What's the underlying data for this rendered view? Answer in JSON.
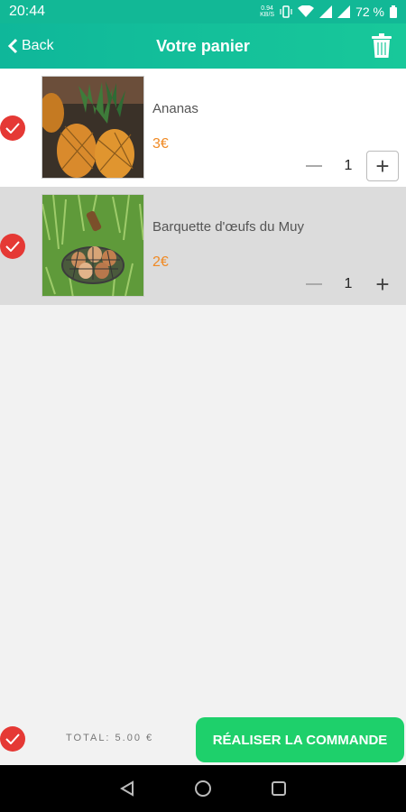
{
  "status_bar": {
    "time": "20:44",
    "net_speed_top": "0.94",
    "net_speed_bottom": "KB/S",
    "battery": "72 %"
  },
  "header": {
    "back_label": "Back",
    "title": "Votre panier"
  },
  "cart": {
    "items": [
      {
        "name": "Ananas",
        "price": "3€",
        "quantity": "1"
      },
      {
        "name": "Barquette d'œufs du Muy",
        "price": "2€",
        "quantity": "1"
      }
    ]
  },
  "footer": {
    "total": "TOTAL: 5.00 €",
    "order_button": "RÉALISER LA COMMANDE"
  },
  "colors": {
    "header": "#12b896",
    "check": "#e53935",
    "price": "#f08a24",
    "order_button": "#1ed06b",
    "selected_row": "#dcdcdc"
  },
  "icons": [
    "back-chevron-icon",
    "trash-icon",
    "check-icon",
    "minus-icon",
    "plus-icon",
    "nav-back-icon",
    "nav-home-icon",
    "nav-recents-icon"
  ]
}
